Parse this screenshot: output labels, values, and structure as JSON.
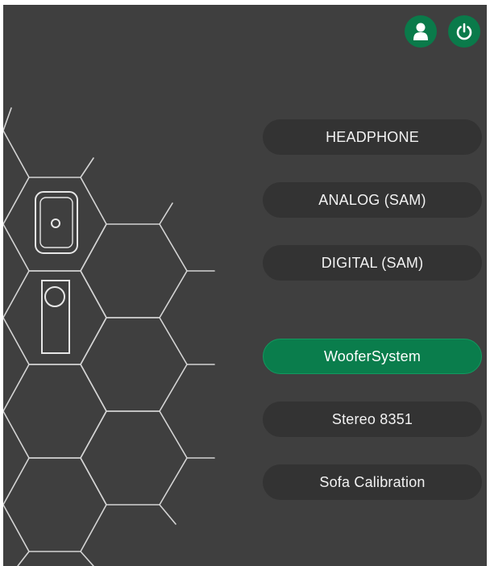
{
  "header": {
    "user_icon": "user-icon",
    "power_icon": "power-icon"
  },
  "illustration": {
    "speaker_icon": "speaker-front-icon",
    "subwoofer_icon": "speaker-tall-icon"
  },
  "menu": {
    "items": [
      {
        "label": "HEADPHONE",
        "active": false
      },
      {
        "label": "ANALOG (SAM)",
        "active": false
      },
      {
        "label": "DIGITAL (SAM)",
        "active": false
      },
      {
        "label": "WooferSystem",
        "active": true
      },
      {
        "label": "Stereo 8351",
        "active": false
      },
      {
        "label": "Sofa Calibration",
        "active": false
      }
    ]
  },
  "colors": {
    "background": "#3f3f3f",
    "button": "#333333",
    "accent": "#0a7d4c",
    "line": "#d9d9d9"
  }
}
